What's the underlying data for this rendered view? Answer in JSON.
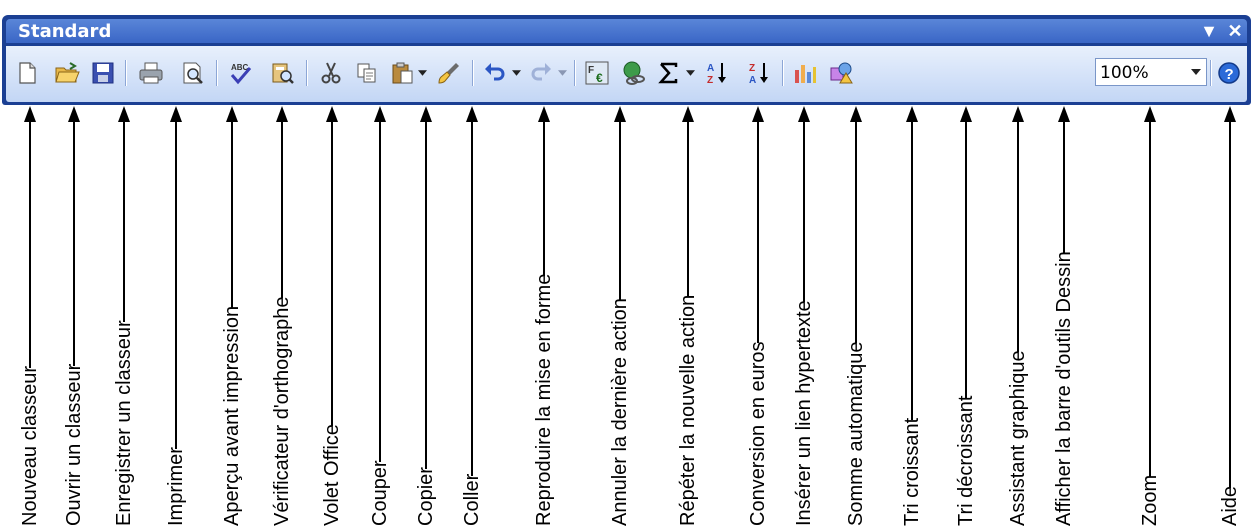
{
  "toolbar": {
    "title": "Standard",
    "menu_glyph": "▼",
    "close_glyph": "✕",
    "zoom_value": "100%",
    "colors": {
      "frame": "#1b3f93",
      "title_bar": "#3a66c6",
      "button_bar": "#d6e3f8",
      "label_text": "#000000"
    }
  },
  "buttons": [
    {
      "name": "new-workbook-button",
      "icon": "new-document-icon",
      "label": "Nouveau classeur"
    },
    {
      "name": "open-workbook-button",
      "icon": "open-folder-icon",
      "label": "Ouvrir un classeur"
    },
    {
      "name": "save-workbook-button",
      "icon": "floppy-disk-icon",
      "label": "Enregistrer un classeur"
    },
    {
      "name": "print-button",
      "icon": "printer-icon",
      "label": "Imprimer"
    },
    {
      "name": "print-preview-button",
      "icon": "print-preview-icon",
      "label": "Aperçu avant impression"
    },
    {
      "name": "spellcheck-button",
      "icon": "spellcheck-icon",
      "label": "Vérificateur d'orthographe"
    },
    {
      "name": "office-pane-button",
      "icon": "research-icon",
      "label": "Volet Office"
    },
    {
      "name": "cut-button",
      "icon": "scissors-icon",
      "label": "Couper"
    },
    {
      "name": "copy-button",
      "icon": "copy-icon",
      "label": "Copier"
    },
    {
      "name": "paste-button",
      "icon": "paste-icon",
      "label": "Coller"
    },
    {
      "name": "format-painter-button",
      "icon": "paintbrush-icon",
      "label": "Reproduire la mise en forme"
    },
    {
      "name": "undo-button",
      "icon": "undo-icon",
      "label": "Annuler la dernière action"
    },
    {
      "name": "redo-button",
      "icon": "redo-icon",
      "label": "Répéter la nouvelle action"
    },
    {
      "name": "euro-conversion-button",
      "icon": "euro-conversion-icon",
      "label": "Conversion en euros"
    },
    {
      "name": "hyperlink-button",
      "icon": "hyperlink-globe-icon",
      "label": "Insérer un lien hypertexte"
    },
    {
      "name": "autosum-button",
      "icon": "sigma-icon",
      "label": "Somme automatique"
    },
    {
      "name": "sort-ascending-button",
      "icon": "sort-ascending-icon",
      "label": "Tri croissant"
    },
    {
      "name": "sort-descending-button",
      "icon": "sort-descending-icon",
      "label": "Tri décroissant"
    },
    {
      "name": "chart-wizard-button",
      "icon": "chart-icon",
      "label": "Assistant graphique"
    },
    {
      "name": "drawing-toolbar-button",
      "icon": "drawing-shapes-icon",
      "label": "Afficher la barre d'outils Dessin"
    },
    {
      "name": "zoom-select",
      "icon": "zoom-dropdown",
      "label": "Zoom"
    },
    {
      "name": "help-button",
      "icon": "help-icon",
      "label": "Aide"
    }
  ]
}
